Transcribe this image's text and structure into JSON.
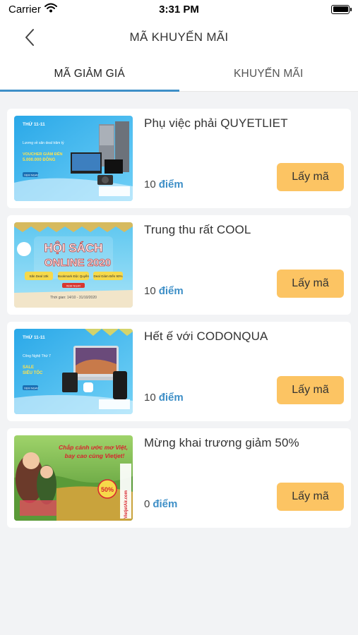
{
  "status_bar": {
    "carrier": "Carrier",
    "time": "3:31 PM"
  },
  "header": {
    "title": "MÃ KHUYẾN MÃI"
  },
  "tabs": [
    {
      "label": "MÃ GIẢM GIÁ",
      "active": true
    },
    {
      "label": "KHUYẾN MÃI",
      "active": false
    }
  ],
  "vouchers": [
    {
      "title": "Phụ việc phải QUYETLIET",
      "points": "10",
      "points_unit": "điểm",
      "button": "Lấy mã",
      "banner": {
        "date_tag": "THỨ 11-11",
        "line1": "Lương về săn deal trăm tỷ",
        "line2": "VOUCHER GIẢM ĐẾN",
        "line3": "5.000.000 ĐỒNG",
        "cta": "XEM NGAY"
      }
    },
    {
      "title": "Trung thu rất COOL",
      "points": "10",
      "points_unit": "điểm",
      "button": "Lấy mã",
      "banner": {
        "headline1": "HỘI SÁCH",
        "headline2": "ONLINE 2020",
        "tag1": "Săn Deal 10k",
        "tag2": "Bookmark Độc Quyền",
        "tag3": "Deal Giảm Đến 90%",
        "cta": "XEM NGAY",
        "dates": "Thời gian: 14/10 - 31/10/2020"
      }
    },
    {
      "title": "Hết ế với CODONQUA",
      "points": "10",
      "points_unit": "điểm",
      "button": "Lấy mã",
      "banner": {
        "date_tag": "THỨ 11-11",
        "line1": "Công Nghệ Thứ 7",
        "line2": "SALE",
        "line3": "SIÊU TỐC",
        "cta": "XEM NGAY"
      }
    },
    {
      "title": "Mừng khai trương giảm 50%",
      "points": "0",
      "points_unit": "điểm",
      "button": "Lấy mã",
      "banner": {
        "headline1": "Chắp cánh ước mơ Việt,",
        "headline2": "bay cao cùng Vietjet!",
        "badge": "50%",
        "brand": "VietjetAir.com"
      }
    }
  ]
}
